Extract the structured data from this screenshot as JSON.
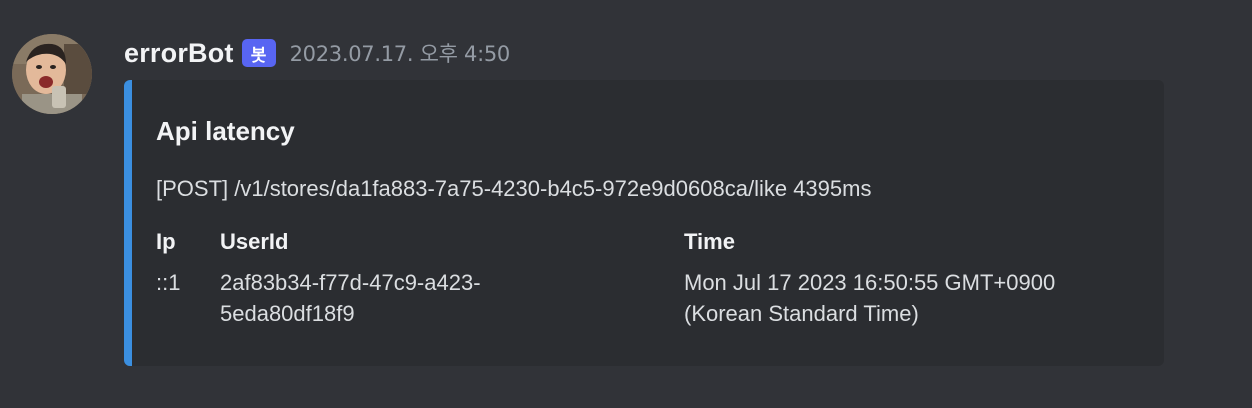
{
  "message": {
    "author": "errorBot",
    "bot_tag": "봇",
    "timestamp": "2023.07.17. 오후 4:50",
    "accent_color": "#3b8fe0"
  },
  "embed": {
    "title": "Api latency",
    "description": "[POST] /v1/stores/da1fa883-7a75-4230-b4c5-972e9d0608ca/like 4395ms",
    "fields": [
      {
        "name": "Ip",
        "value": "::1"
      },
      {
        "name": "UserId",
        "value": "2af83b34-f77d-47c9-a423-\n5eda80df18f9"
      },
      {
        "name": "Time",
        "value": "Mon Jul 17 2023 16:50:55 GMT+0900\n(Korean Standard Time)"
      }
    ]
  }
}
